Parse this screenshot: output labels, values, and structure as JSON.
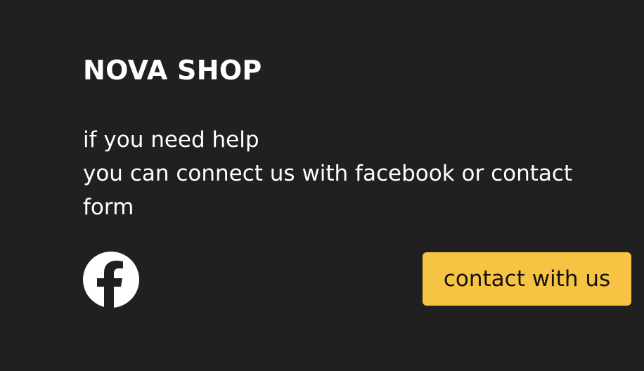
{
  "brand": {
    "name": "NOVA SHOP"
  },
  "help": {
    "lines": [
      "if you need help",
      "you can connect us with facebook or contact",
      "form"
    ]
  },
  "social": {
    "facebook": {
      "icon": "facebook-icon"
    }
  },
  "actions": {
    "contact_label": "contact with us"
  },
  "colors": {
    "background": "#202020",
    "text": "#ffffff",
    "accent": "#f6c343",
    "button_text": "#111111"
  }
}
